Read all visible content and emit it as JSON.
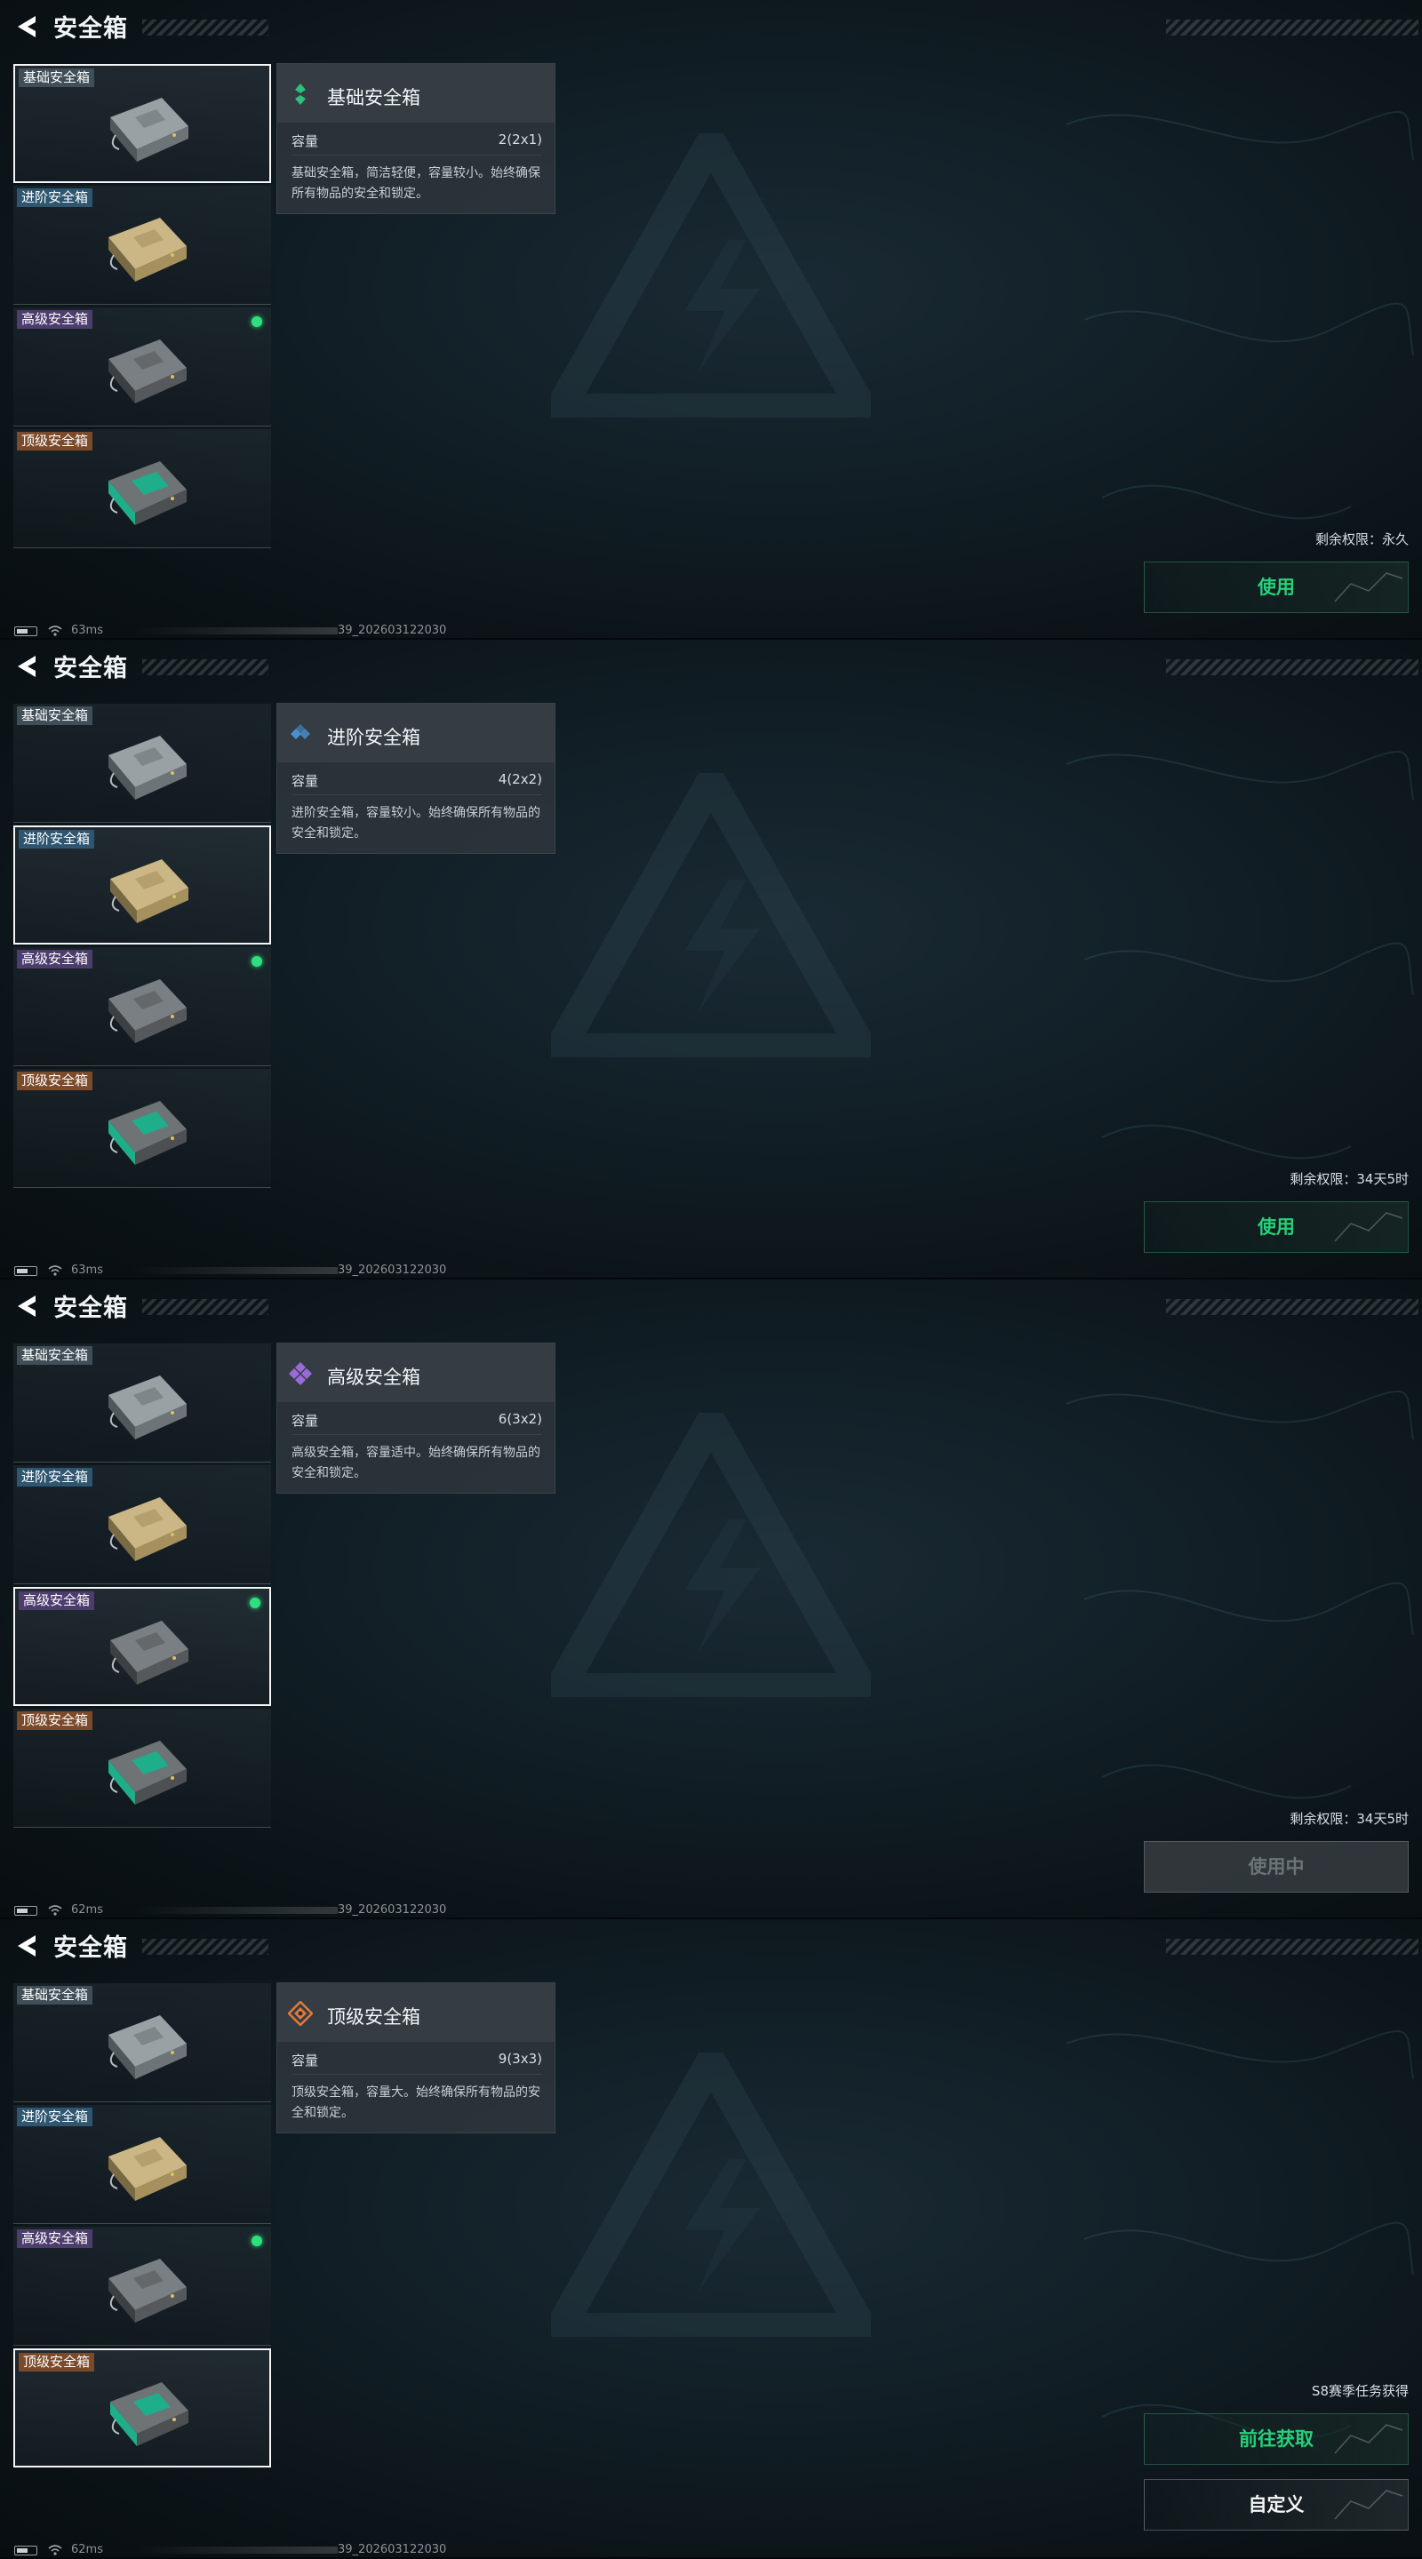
{
  "panels": [
    {
      "header": {
        "title": "安全箱"
      },
      "items": [
        {
          "label": "基础安全箱"
        },
        {
          "label": "进阶安全箱"
        },
        {
          "label": "高级安全箱"
        },
        {
          "label": "顶级安全箱"
        }
      ],
      "selected_index": 0,
      "card": {
        "title": "基础安全箱",
        "capacity_label": "容量",
        "capacity_value": "2(2x1)",
        "description": "基础安全箱，简洁轻便，容量较小。始终确保所有物品的安全和锁定。",
        "rank_icon": "rank-basic-icon",
        "rank_color": "#2ec07a"
      },
      "permission": "剩余权限：永久",
      "buttons": [
        {
          "label": "使用",
          "style": "green"
        }
      ],
      "status": {
        "ping": "63ms",
        "build": "39_202603122030"
      }
    },
    {
      "header": {
        "title": "安全箱"
      },
      "items": [
        {
          "label": "基础安全箱"
        },
        {
          "label": "进阶安全箱"
        },
        {
          "label": "高级安全箱"
        },
        {
          "label": "顶级安全箱"
        }
      ],
      "selected_index": 1,
      "card": {
        "title": "进阶安全箱",
        "capacity_label": "容量",
        "capacity_value": "4(2x2)",
        "description": "进阶安全箱，容量较小。始终确保所有物品的安全和锁定。",
        "rank_icon": "rank-advanced-icon",
        "rank_color": "#4a90d0"
      },
      "permission": "剩余权限：34天5时",
      "buttons": [
        {
          "label": "使用",
          "style": "green"
        }
      ],
      "status": {
        "ping": "63ms",
        "build": "39_202603122030"
      }
    },
    {
      "header": {
        "title": "安全箱"
      },
      "items": [
        {
          "label": "基础安全箱"
        },
        {
          "label": "进阶安全箱"
        },
        {
          "label": "高级安全箱"
        },
        {
          "label": "顶级安全箱"
        }
      ],
      "selected_index": 2,
      "card": {
        "title": "高级安全箱",
        "capacity_label": "容量",
        "capacity_value": "6(3x2)",
        "description": "高级安全箱，容量适中。始终确保所有物品的安全和锁定。",
        "rank_icon": "rank-high-icon",
        "rank_color": "#9a6ad8"
      },
      "permission": "剩余权限：34天5时",
      "buttons": [
        {
          "label": "使用中",
          "style": "gray"
        }
      ],
      "status": {
        "ping": "62ms",
        "build": "39_202603122030"
      }
    },
    {
      "header": {
        "title": "安全箱"
      },
      "items": [
        {
          "label": "基础安全箱"
        },
        {
          "label": "进阶安全箱"
        },
        {
          "label": "高级安全箱"
        },
        {
          "label": "顶级安全箱"
        }
      ],
      "selected_index": 3,
      "card": {
        "title": "顶级安全箱",
        "capacity_label": "容量",
        "capacity_value": "9(3x3)",
        "description": "顶级安全箱，容量大。始终确保所有物品的安全和锁定。",
        "rank_icon": "rank-top-icon",
        "rank_color": "#e07a3a"
      },
      "permission": "S8赛季任务获得",
      "buttons": [
        {
          "label": "前往获取",
          "style": "green"
        },
        {
          "label": "自定义",
          "style": "white"
        }
      ],
      "status": {
        "ping": "62ms",
        "build": "39_202603122030"
      }
    }
  ],
  "colors": {
    "accent_green": "#27d07a",
    "equipped_dot": "#2ee07c"
  }
}
